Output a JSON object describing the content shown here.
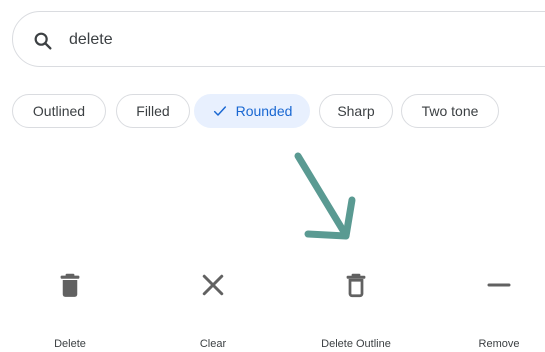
{
  "search": {
    "value": "delete",
    "icon": "search-icon"
  },
  "chips": [
    {
      "label": "Outlined",
      "selected": false
    },
    {
      "label": "Filled",
      "selected": false
    },
    {
      "label": "Rounded",
      "selected": true
    },
    {
      "label": "Sharp",
      "selected": false
    },
    {
      "label": "Two tone",
      "selected": false
    }
  ],
  "icons": [
    {
      "label": "Delete",
      "icon": "delete-icon"
    },
    {
      "label": "Clear",
      "icon": "clear-icon"
    },
    {
      "label": "Delete Outline",
      "icon": "delete-outline-icon"
    },
    {
      "label": "Remove",
      "icon": "remove-icon"
    }
  ],
  "colors": {
    "accent": "#1967d2",
    "chip_selected_bg": "#e8f0fe",
    "arrow": "#5a9a92",
    "icon": "#616161"
  }
}
